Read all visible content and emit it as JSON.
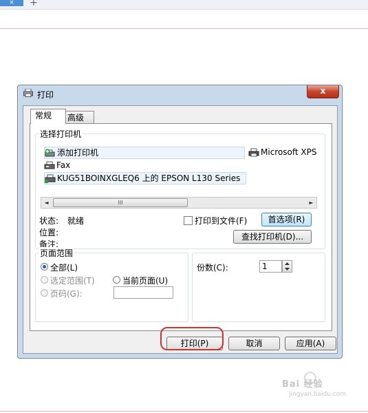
{
  "browser": {
    "close_tab": "×",
    "new_tab": "+"
  },
  "dialog": {
    "title": "打印",
    "close_glyph": "x",
    "tabs": [
      "常规",
      "高级"
    ],
    "select_printer": {
      "legend": "选择打印机",
      "printers": [
        {
          "name": "添加打印机",
          "icon": "add-printer-icon"
        },
        {
          "name": "Microsoft XPS",
          "icon": "printer-icon"
        },
        {
          "name": "Fax",
          "icon": "fax-icon"
        },
        {
          "name": "KUG51BOINXGLEQ6 上的 EPSON L130 Series",
          "icon": "network-printer-icon"
        }
      ],
      "scroll_left": "◄",
      "scroll_right": "►",
      "scroll_grip": "III",
      "status_label": "状态:",
      "status_value": "就绪",
      "location_label": "位置:",
      "comment_label": "备注:",
      "print_to_file": "打印到文件(F)",
      "preferences_button": "首选项(R)",
      "find_printer_button": "查找打印机(D)..."
    },
    "page_range": {
      "legend": "页面范围",
      "all": "全部(L)",
      "selection": "选定范围(T)",
      "current_page": "当前页面(U)",
      "pages": "页码(G):",
      "pages_value": "",
      "selected": "all"
    },
    "copies": {
      "label": "份数(C):",
      "value": "1"
    },
    "buttons": {
      "print": "打印(P)",
      "cancel": "取消",
      "apply": "应用(A)"
    }
  },
  "watermark": {
    "brand": "Bai 经验",
    "url": "jingyan.baidu.com"
  },
  "colors": {
    "highlight_circle": "#d9302c",
    "close_button": "#c7452d",
    "title_bar": "#c9d9ec"
  }
}
